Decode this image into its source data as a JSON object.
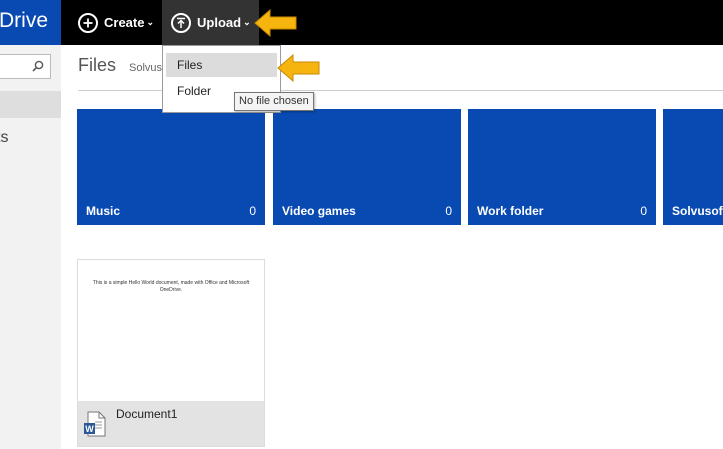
{
  "topbar": {
    "brand": "Drive",
    "create_label": "Create",
    "upload_label": "Upload"
  },
  "page": {
    "title": "Files",
    "breadcrumb": "Solvusoft"
  },
  "upload_menu": {
    "items": [
      {
        "label": "Files"
      },
      {
        "label": "Folder"
      }
    ],
    "tooltip": "No file chosen"
  },
  "folders": [
    {
      "name": "Music",
      "count": "0"
    },
    {
      "name": "Video games",
      "count": "0"
    },
    {
      "name": "Work folder",
      "count": "0"
    },
    {
      "name": "Solvusoft",
      "count": ""
    }
  ],
  "documents": [
    {
      "name": "Document1",
      "preview": "This is a simple Hello World document, made with Office and Microsoft OneDrive.",
      "icon": "word-icon"
    }
  ],
  "leftnav": {
    "partial_label": "ts"
  },
  "colors": {
    "brand_blue": "#094ab2",
    "topbar": "#000000",
    "arrow": "#f6b40e"
  }
}
